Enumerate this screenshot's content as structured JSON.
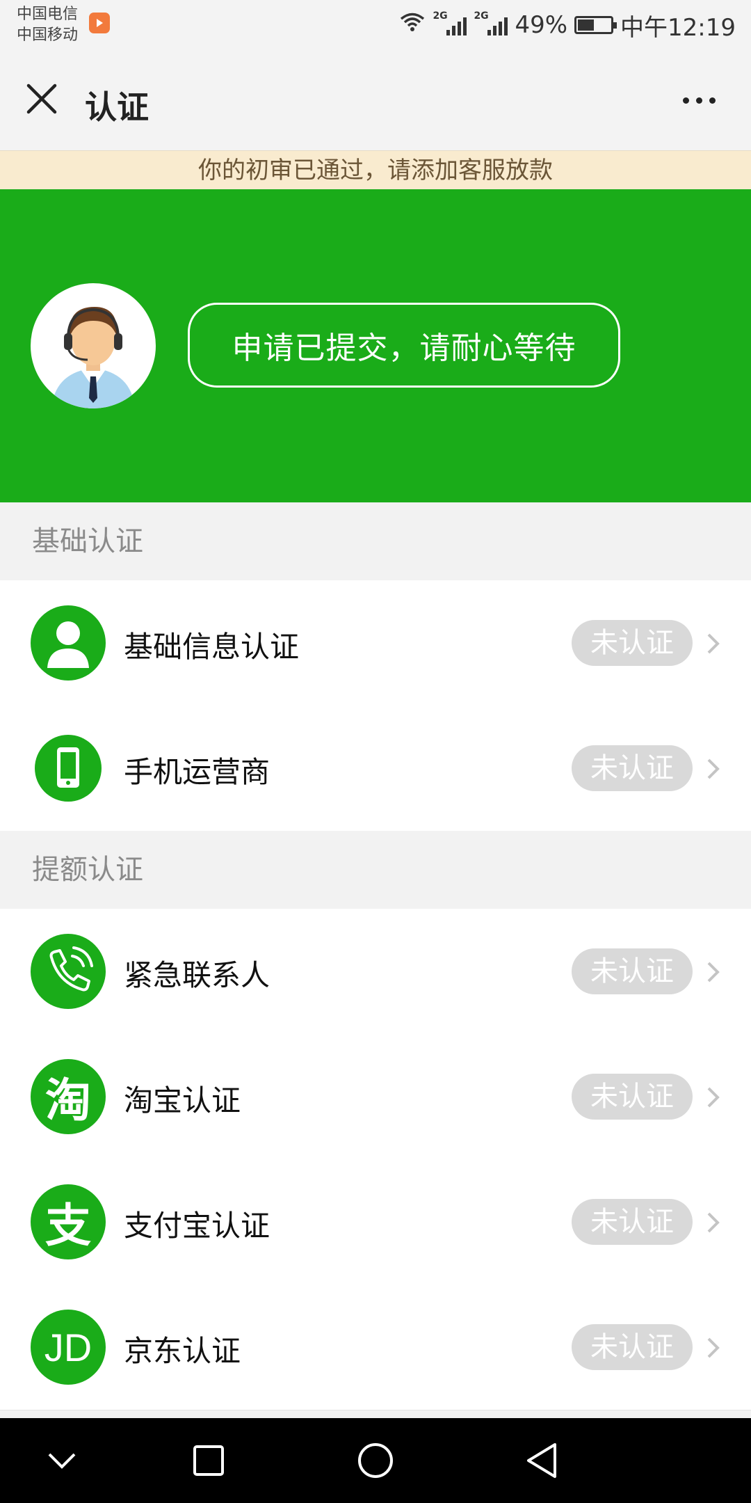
{
  "status_bar": {
    "carrier_1": "中国电信",
    "carrier_2": "中国移动",
    "network_1": "2G",
    "network_2": "2G",
    "battery": "49%",
    "battery_level": 0.49,
    "time": "中午12:19"
  },
  "nav": {
    "title": "认证",
    "close_icon": "close-icon",
    "more_icon": "more-icon"
  },
  "notice": "你的初审已通过，请添加客服放款",
  "banner": {
    "status": "申请已提交，请耐心等待",
    "background": "#1aac19"
  },
  "sections": [
    {
      "title": "基础认证",
      "items": [
        {
          "label": "基础信息认证",
          "icon": "user-icon",
          "status": "未认证"
        },
        {
          "label": "手机运营商",
          "icon": "phone-icon",
          "status": "未认证"
        }
      ]
    },
    {
      "title": "提额认证",
      "items": [
        {
          "label": "紧急联系人",
          "icon": "call-icon",
          "status": "未认证"
        },
        {
          "label": "淘宝认证",
          "icon": "taobao-icon",
          "status": "未认证"
        },
        {
          "label": "支付宝认证",
          "icon": "alipay-icon",
          "status": "未认证"
        },
        {
          "label": "京东认证",
          "icon": "jd-icon",
          "status": "未认证"
        }
      ]
    }
  ],
  "icon_text": {
    "taobao": "淘",
    "alipay": "支",
    "jd": "JD"
  },
  "system_nav": [
    "back-down-icon",
    "recents-icon",
    "home-icon",
    "back-icon"
  ]
}
